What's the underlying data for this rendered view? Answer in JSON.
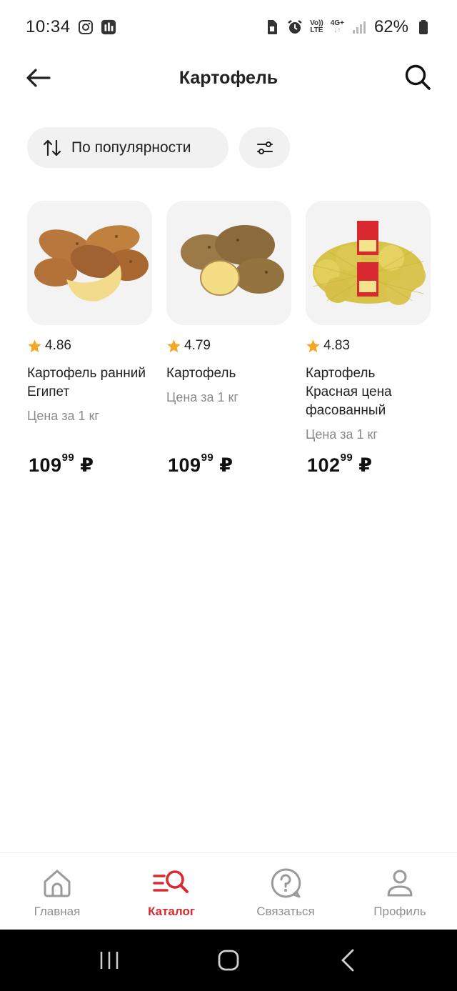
{
  "status_bar": {
    "time": "10:34",
    "network_top": "Vo))",
    "network_bottom": "LTE",
    "gen": "4G+",
    "battery": "62%"
  },
  "header": {
    "title": "Картофель"
  },
  "sort": {
    "label": "По популярности"
  },
  "products": [
    {
      "rating": "4.86",
      "name": "Картофель ранний Египет",
      "unit": "Цена за 1 кг",
      "price_main": "109",
      "price_cents": "99",
      "currency": "₽"
    },
    {
      "rating": "4.79",
      "name": "Картофель",
      "unit": "Цена за 1 кг",
      "price_main": "109",
      "price_cents": "99",
      "currency": "₽"
    },
    {
      "rating": "4.83",
      "name": "Картофель Красная цена фасованный",
      "unit": "Цена за 1 кг",
      "price_main": "102",
      "price_cents": "99",
      "currency": "₽"
    }
  ],
  "bottom_nav": [
    {
      "label": "Главная",
      "icon": "home-icon"
    },
    {
      "label": "Каталог",
      "icon": "catalog-search-icon",
      "active": true
    },
    {
      "label": "Связаться",
      "icon": "help-chat-icon"
    },
    {
      "label": "Профиль",
      "icon": "profile-icon"
    }
  ],
  "colors": {
    "accent": "#d9282f",
    "star": "#f5a623",
    "chip_bg": "#f1f1f1"
  }
}
